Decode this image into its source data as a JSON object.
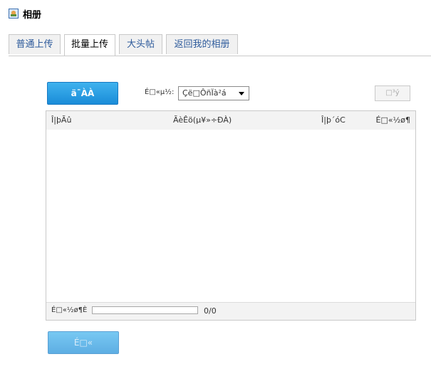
{
  "header": {
    "title": "相册",
    "icon": "album-icon"
  },
  "tabs": [
    {
      "label": "普通上传",
      "active": false
    },
    {
      "label": "批量上传",
      "active": true
    },
    {
      "label": "大头帖",
      "active": false
    },
    {
      "label": "返回我的相册",
      "active": false
    }
  ],
  "toolbar": {
    "select_files_label": "ä¯ÀÀ",
    "destination_label": "É□«µ½:",
    "destination_value": "Çë□ÔñÏà²á",
    "clear_label": "□³ý"
  },
  "file_table": {
    "columns": [
      "Î|þÃû",
      "ÃèÊö(µ¥»÷ÐÀ)",
      "Î|þ´óC",
      "É□«½ø¶"
    ],
    "rows": []
  },
  "footer": {
    "total_label": "É□«½ø¶È",
    "progress": 0,
    "count_text": "0/0"
  },
  "upload_button_label": "É□«",
  "colors": {
    "accent": "#1a8cd8",
    "tab_text": "#2d5a9b"
  }
}
